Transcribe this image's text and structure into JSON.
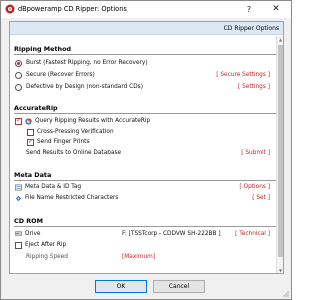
{
  "window": {
    "title": "dBpoweramp CD Ripper: Options",
    "help_label": "?",
    "close_label": "✕"
  },
  "header": {
    "label": "CD Ripper Options"
  },
  "ripping_method": {
    "title": "Ripping Method",
    "options": [
      {
        "label": "Burst   (Fastest Ripping, no Error Recovery)",
        "selected": true
      },
      {
        "label": "Secure   (Recover Errors)",
        "link": "[ Secure Settings ]",
        "selected": false
      },
      {
        "label": "Defective by Design (non-standard CDs)",
        "link": "[ Settings ]",
        "selected": false
      }
    ]
  },
  "accuraterip": {
    "title": "AccurateRip",
    "query_label": "Query Ripping Results with AccurateRip",
    "query_checked": true,
    "cross_label": "Cross-Pressing Verification",
    "cross_checked": false,
    "finger_label": "Send Finger Prints",
    "finger_checked": true,
    "send_label": "Send Results to Online Database",
    "send_link": "[ Submit ]"
  },
  "meta_data": {
    "title": "Meta Data",
    "id_tag_label": "Meta Data & ID Tag",
    "id_tag_link": "[ Options ]",
    "filename_label": "File Name Restricted Characters",
    "filename_link": "[ Set ]"
  },
  "cd_rom": {
    "title": "CD ROM",
    "drive_label": "Drive",
    "drive_value": "F:    [TSSTcorp - CDDVW SH-222BB ]",
    "drive_link": "[ Technical ]",
    "eject_label": "Eject After Rip",
    "eject_checked": false,
    "partial_label": "Ripping Speed",
    "partial_value": "[Maximum]"
  },
  "buttons": {
    "ok": "OK",
    "cancel": "Cancel"
  },
  "colors": {
    "accent": "#c0262a",
    "header_bg": "#dde8f5",
    "focus": "#0078d7"
  }
}
